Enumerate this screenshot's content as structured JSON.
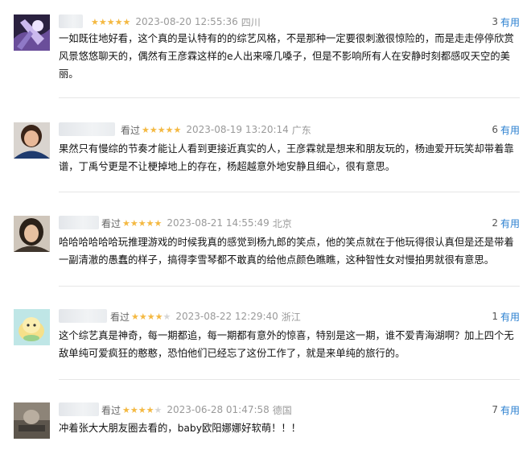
{
  "reviews": [
    {
      "status": "",
      "rating": 5,
      "time": "2023-08-20 12:55:36",
      "location": "四川",
      "useful_count": "3",
      "useful_label": "有用",
      "content": "一如既往地好看，这个真的是认特有的的综艺风格，不是那种一定要很刺激很惊险的，而是走走停停欣赏风景悠悠聊天的，偶然有王彦霖这样的e人出来嚎几嗓子，但是不影响所有人在安静时刻都感叹天空的美丽。"
    },
    {
      "status": "看过",
      "rating": 5,
      "time": "2023-08-19 13:20:14",
      "location": "广东",
      "useful_count": "6",
      "useful_label": "有用",
      "content": "果然只有慢综的节奏才能让人看到更接近真实的人，王彦霖就是想来和朋友玩的，杨迪爱开玩笑却带着靠谱，丁禹兮更是不让梗掉地上的存在，杨超越意外地安静且细心，很有意思。"
    },
    {
      "status": "看过",
      "rating": 5,
      "time": "2023-08-21 14:55:49",
      "location": "北京",
      "useful_count": "2",
      "useful_label": "有用",
      "content": "哈哈哈哈哈哈玩推理游戏的时候我真的感觉到杨九郎的笑点，他的笑点就在于他玩得很认真但是还是带着一副清澈的愚蠢的样子，搞得李雪琴都不敢真的给他点颜色瞧瞧，这种智性女对慢拍男就很有意思。"
    },
    {
      "status": "看过",
      "rating": 4,
      "time": "2023-08-22 12:29:40",
      "location": "浙江",
      "useful_count": "1",
      "useful_label": "有用",
      "content": "这个综艺真是神奇，每一期都追，每一期都有意外的惊喜，特别是这一期，谁不爱青海湖啊？加上四个无敌单纯可爱疯狂的憨憨，恐怕他们已经忘了这份工作了，就是来单纯的旅行的。"
    },
    {
      "status": "看过",
      "rating": 4,
      "time": "2023-06-28 01:47:58",
      "location": "德国",
      "useful_count": "7",
      "useful_label": "有用",
      "content": "冲着张大大朋友圈去看的，baby欧阳娜娜好软萌！！！"
    }
  ]
}
